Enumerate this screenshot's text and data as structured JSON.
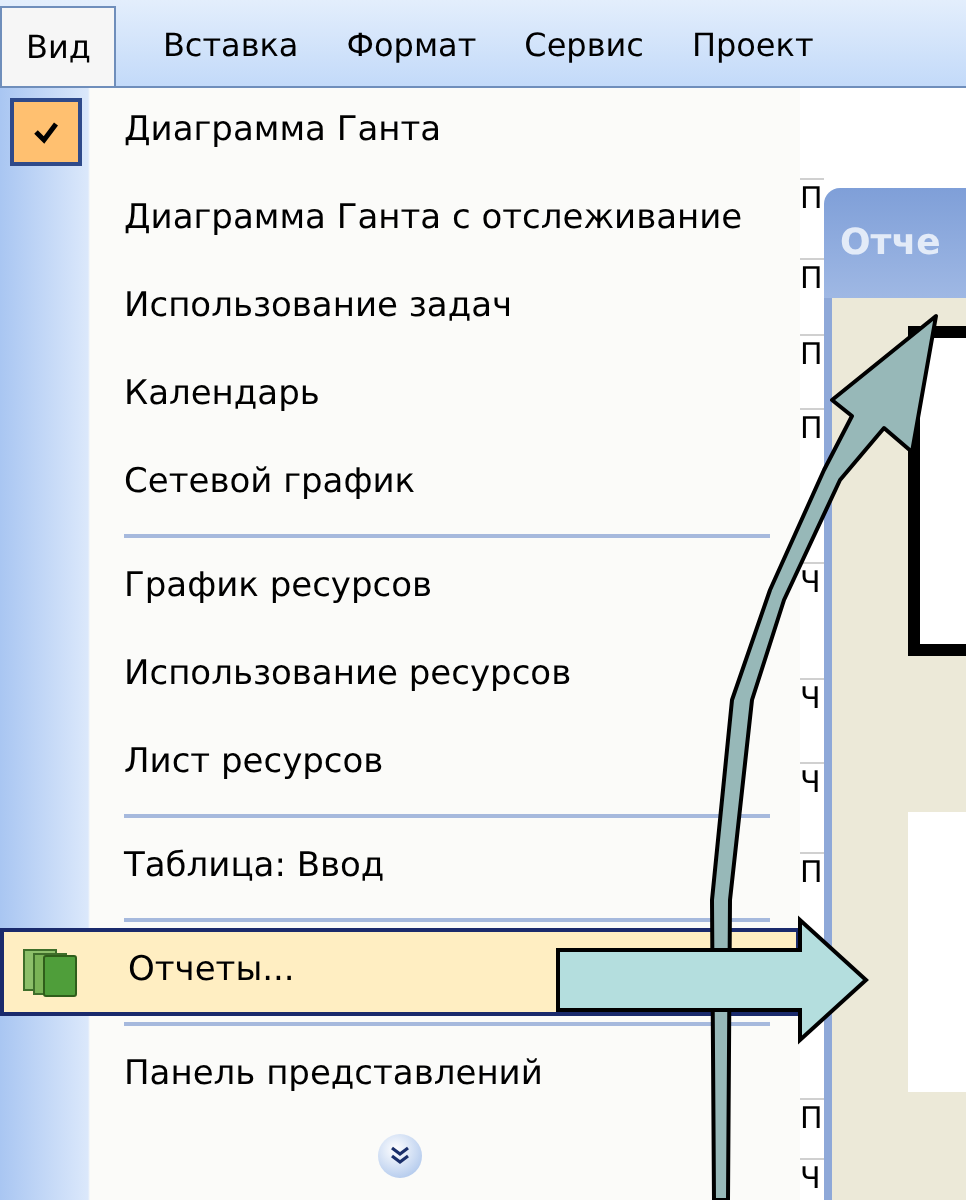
{
  "menu_bar": [
    {
      "label": "Вид",
      "selected": true
    },
    {
      "label": "Вставка",
      "selected": false
    },
    {
      "label": "Формат",
      "selected": false
    },
    {
      "label": "Сервис",
      "selected": false
    },
    {
      "label": "Проект",
      "selected": false
    }
  ],
  "menu": {
    "items": [
      {
        "kind": "item",
        "label": "Диаграмма Ганта",
        "checked": true,
        "selected": false
      },
      {
        "kind": "item",
        "label": "Диаграмма Ганта с отслеживание",
        "checked": false,
        "selected": false
      },
      {
        "kind": "item",
        "label": "Использование задач",
        "checked": false,
        "selected": false
      },
      {
        "kind": "item",
        "label": "Календарь",
        "checked": false,
        "selected": false
      },
      {
        "kind": "item",
        "label": "Сетевой график",
        "checked": false,
        "selected": false
      },
      {
        "kind": "separator"
      },
      {
        "kind": "item",
        "label": "График ресурсов",
        "checked": false,
        "selected": false
      },
      {
        "kind": "item",
        "label": "Использование ресурсов",
        "checked": false,
        "selected": false
      },
      {
        "kind": "item",
        "label": "Лист ресурсов",
        "checked": false,
        "selected": false
      },
      {
        "kind": "separator"
      },
      {
        "kind": "item",
        "label": "Таблица: Ввод",
        "checked": false,
        "selected": false
      },
      {
        "kind": "separator"
      },
      {
        "kind": "icon_item",
        "label": "Отчеты...",
        "checked": false,
        "selected": true
      },
      {
        "kind": "separator"
      },
      {
        "kind": "item",
        "label": "Панель представлений",
        "checked": false,
        "selected": false
      },
      {
        "kind": "more"
      }
    ]
  },
  "column_cells": [
    "П",
    "П",
    "П",
    "П",
    "Ч",
    "Ч",
    "Ч",
    "П",
    "П",
    "Ч"
  ],
  "dialog": {
    "title": "Отче"
  }
}
